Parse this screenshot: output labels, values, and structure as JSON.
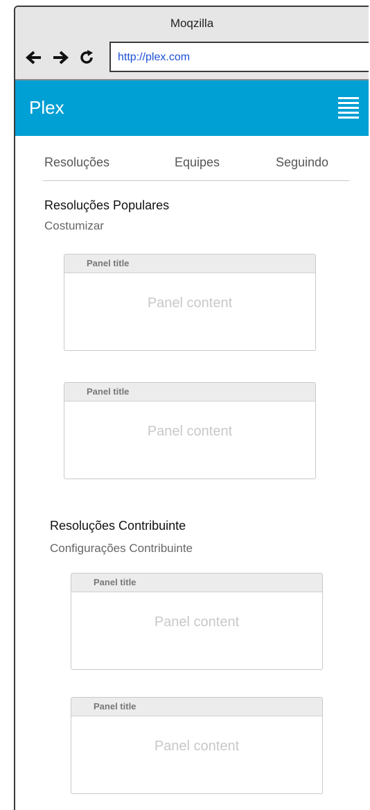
{
  "browser": {
    "title": "Moqzilla",
    "url": "http://plex.com",
    "nav": [
      "back-arrow",
      "forward-arrow",
      "reload"
    ]
  },
  "app": {
    "title": "Plex",
    "menu_icon": "hamburger-menu-icon",
    "accent": "#009fd4"
  },
  "tabs": [
    {
      "label": "Resoluções"
    },
    {
      "label": "Equipes"
    },
    {
      "label": "Seguindo"
    }
  ],
  "sections": [
    {
      "title": "Resoluções Populares",
      "link": "Costumizar",
      "panels": [
        {
          "title": "Panel title",
          "content": "Panel content"
        },
        {
          "title": "Panel title",
          "content": "Panel content"
        }
      ]
    },
    {
      "title": "Resoluções Contribuinte",
      "link": "Configurações Contribuinte",
      "panels": [
        {
          "title": "Panel title",
          "content": "Panel content"
        },
        {
          "title": "Panel title",
          "content": "Panel content"
        }
      ]
    }
  ]
}
